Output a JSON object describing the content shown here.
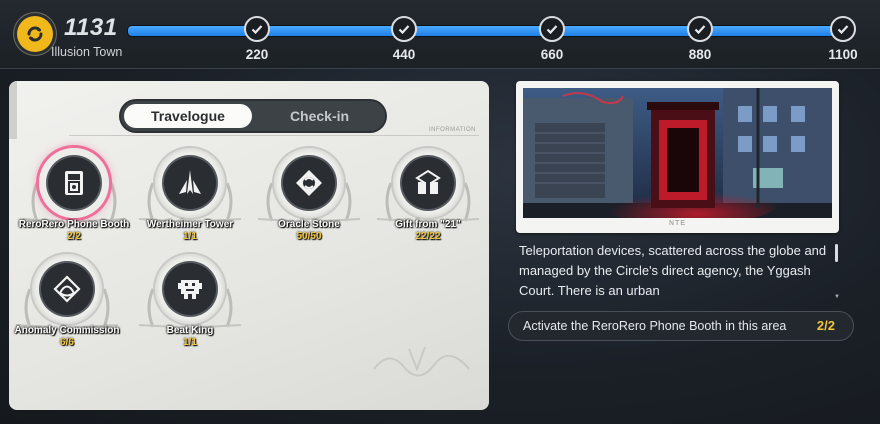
{
  "header": {
    "level": "1131",
    "area_name": "Illusion Town",
    "progress_fraction": 1.0,
    "milestones": [
      {
        "label": "220",
        "claimed": true
      },
      {
        "label": "440",
        "claimed": true
      },
      {
        "label": "660",
        "claimed": true
      },
      {
        "label": "880",
        "claimed": true
      },
      {
        "label": "1100",
        "claimed": true
      }
    ]
  },
  "tabs": {
    "active": "Travelogue",
    "inactive": "Check-in"
  },
  "info_label": "INFORMATION",
  "badges": [
    {
      "name": "ReroRero Phone Booth",
      "count": "2/2",
      "icon": "phone-booth-icon",
      "selected": true
    },
    {
      "name": "Wertheimer Tower",
      "count": "1/1",
      "icon": "tower-icon",
      "selected": false
    },
    {
      "name": "Oracle Stone",
      "count": "50/50",
      "icon": "oracle-stone-icon",
      "selected": false
    },
    {
      "name": "Gift from \"21\"",
      "count": "22/22",
      "icon": "gift-box-icon",
      "selected": false
    },
    {
      "name": "Anomaly Commission",
      "count": "6/6",
      "icon": "anomaly-icon",
      "selected": false
    },
    {
      "name": "Beat King",
      "count": "1/1",
      "icon": "beat-king-icon",
      "selected": false
    }
  ],
  "detail": {
    "art_caption": "NTE",
    "description": "Teleportation devices, scattered across the globe and managed by the Circle's direct agency, the Yggash Court. There is an urban",
    "task_text": "Activate the ReroRero Phone Booth in this area",
    "task_count": "2/2"
  },
  "colors": {
    "accent_blue": "#2f8ff0",
    "count_gold": "#f1c53c",
    "selected_pink": "#ee6f9a",
    "level_gold": "#f0b81a"
  }
}
